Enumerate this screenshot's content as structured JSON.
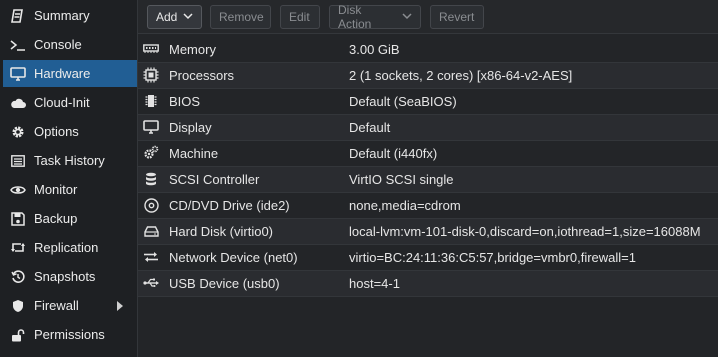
{
  "sidebar": {
    "items": [
      {
        "label": "Summary",
        "icon": "summary-icon"
      },
      {
        "label": "Console",
        "icon": "console-icon"
      },
      {
        "label": "Hardware",
        "icon": "monitor-icon",
        "active": true
      },
      {
        "label": "Cloud-Init",
        "icon": "cloud-icon"
      },
      {
        "label": "Options",
        "icon": "gear-icon"
      },
      {
        "label": "Task History",
        "icon": "list-icon"
      },
      {
        "label": "Monitor",
        "icon": "eye-icon"
      },
      {
        "label": "Backup",
        "icon": "floppy-icon"
      },
      {
        "label": "Replication",
        "icon": "retweet-icon"
      },
      {
        "label": "Snapshots",
        "icon": "history-icon"
      },
      {
        "label": "Firewall",
        "icon": "shield-icon"
      },
      {
        "label": "Permissions",
        "icon": "unlock-icon"
      }
    ]
  },
  "toolbar": {
    "add_label": "Add",
    "remove_label": "Remove",
    "edit_label": "Edit",
    "disk_action_label": "Disk Action",
    "revert_label": "Revert"
  },
  "hardware": {
    "rows": [
      {
        "name": "Memory",
        "value": "3.00 GiB",
        "icon": "memory-icon"
      },
      {
        "name": "Processors",
        "value": "2 (1 sockets, 2 cores) [x86-64-v2-AES]",
        "icon": "cpu-icon"
      },
      {
        "name": "BIOS",
        "value": "Default (SeaBIOS)",
        "icon": "bios-chip-icon"
      },
      {
        "name": "Display",
        "value": "Default",
        "icon": "display-icon"
      },
      {
        "name": "Machine",
        "value": "Default (i440fx)",
        "icon": "cogs-icon"
      },
      {
        "name": "SCSI Controller",
        "value": "VirtIO SCSI single",
        "icon": "database-icon"
      },
      {
        "name": "CD/DVD Drive (ide2)",
        "value": "none,media=cdrom",
        "icon": "cdrom-icon"
      },
      {
        "name": "Hard Disk (virtio0)",
        "value": "local-lvm:vm-101-disk-0,discard=on,iothread=1,size=16088M",
        "icon": "hdd-icon"
      },
      {
        "name": "Network Device (net0)",
        "value": "virtio=BC:24:11:36:C5:57,bridge=vmbr0,firewall=1",
        "icon": "exchange-icon"
      },
      {
        "name": "USB Device (usb0)",
        "value": "host=4-1",
        "icon": "usb-icon"
      }
    ]
  },
  "colors": {
    "accent": "#215e94",
    "background": "#1e2023"
  }
}
